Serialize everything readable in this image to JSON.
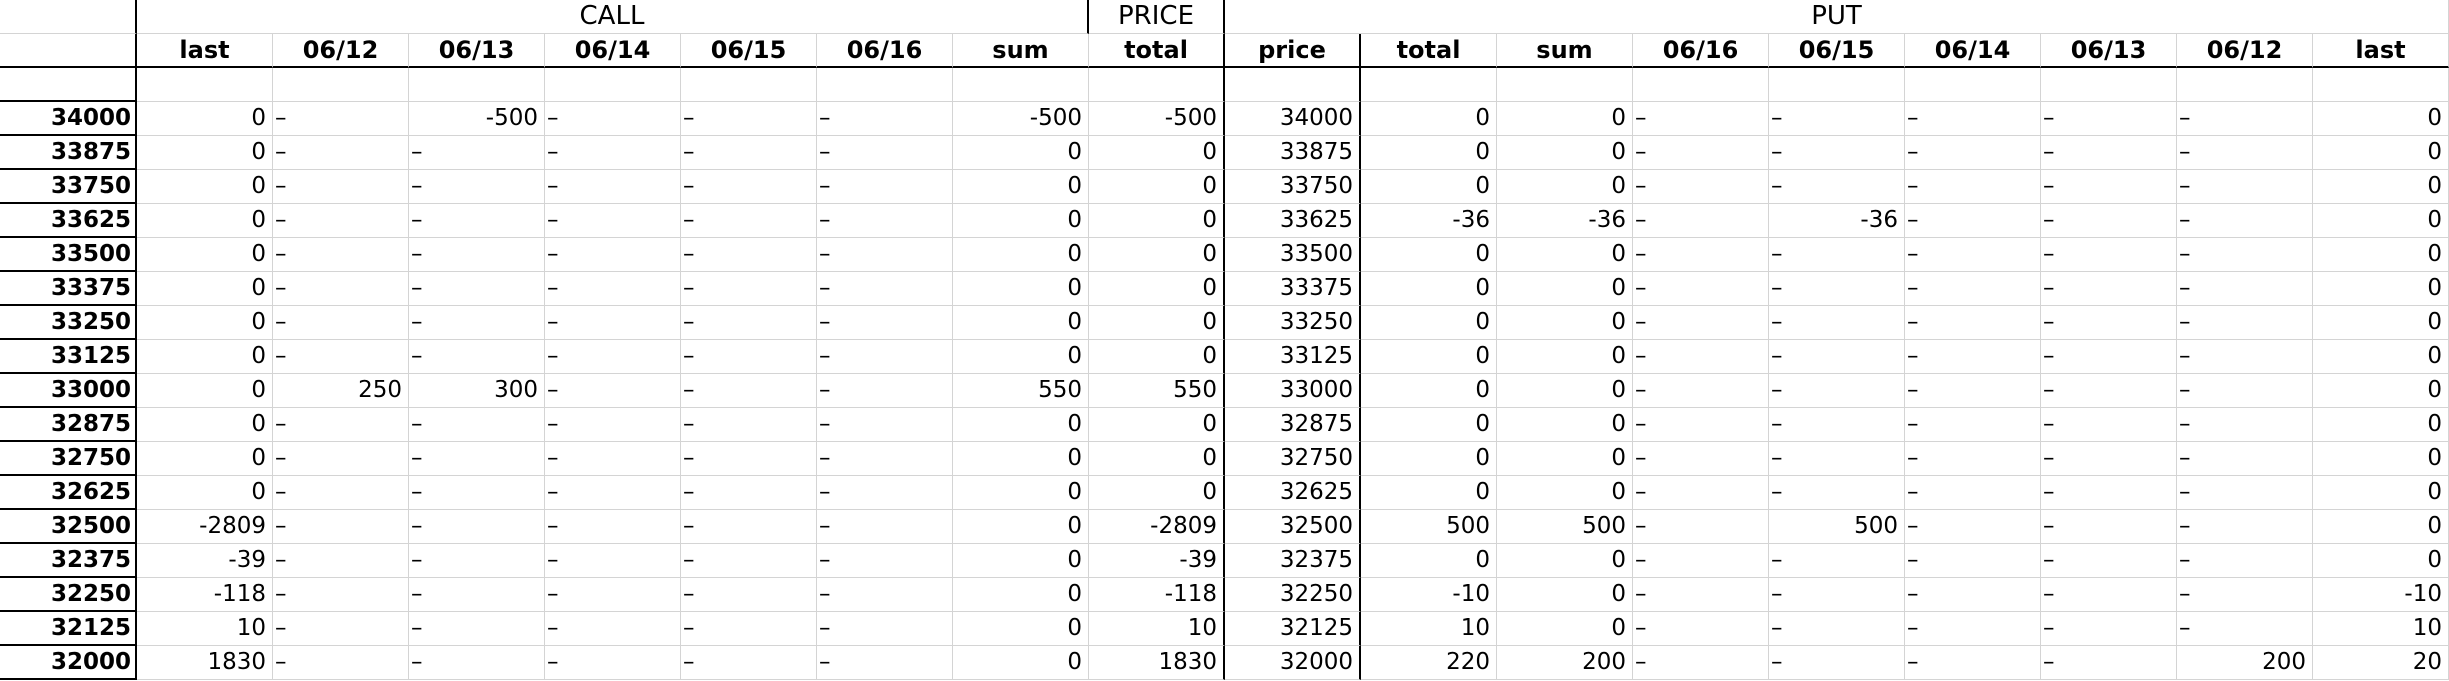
{
  "groups": {
    "call": "CALL",
    "price": "PRICE",
    "put": "PUT"
  },
  "headers": [
    "last",
    "06/12",
    "06/13",
    "06/14",
    "06/15",
    "06/16",
    "sum",
    "total",
    "price",
    "total",
    "sum",
    "06/16",
    "06/15",
    "06/14",
    "06/13",
    "06/12",
    "last"
  ],
  "rows": [
    {
      "strike": "34000",
      "cells": [
        "0",
        "–",
        "-500",
        "–",
        "–",
        "–",
        "-500",
        "-500",
        "34000",
        "0",
        "0",
        "–",
        "–",
        "–",
        "–",
        "–",
        "0"
      ]
    },
    {
      "strike": "33875",
      "cells": [
        "0",
        "–",
        "–",
        "–",
        "–",
        "–",
        "0",
        "0",
        "33875",
        "0",
        "0",
        "–",
        "–",
        "–",
        "–",
        "–",
        "0"
      ]
    },
    {
      "strike": "33750",
      "cells": [
        "0",
        "–",
        "–",
        "–",
        "–",
        "–",
        "0",
        "0",
        "33750",
        "0",
        "0",
        "–",
        "–",
        "–",
        "–",
        "–",
        "0"
      ]
    },
    {
      "strike": "33625",
      "cells": [
        "0",
        "–",
        "–",
        "–",
        "–",
        "–",
        "0",
        "0",
        "33625",
        "-36",
        "-36",
        "–",
        "-36",
        "–",
        "–",
        "–",
        "0"
      ]
    },
    {
      "strike": "33500",
      "cells": [
        "0",
        "–",
        "–",
        "–",
        "–",
        "–",
        "0",
        "0",
        "33500",
        "0",
        "0",
        "–",
        "–",
        "–",
        "–",
        "–",
        "0"
      ]
    },
    {
      "strike": "33375",
      "cells": [
        "0",
        "–",
        "–",
        "–",
        "–",
        "–",
        "0",
        "0",
        "33375",
        "0",
        "0",
        "–",
        "–",
        "–",
        "–",
        "–",
        "0"
      ]
    },
    {
      "strike": "33250",
      "cells": [
        "0",
        "–",
        "–",
        "–",
        "–",
        "–",
        "0",
        "0",
        "33250",
        "0",
        "0",
        "–",
        "–",
        "–",
        "–",
        "–",
        "0"
      ]
    },
    {
      "strike": "33125",
      "cells": [
        "0",
        "–",
        "–",
        "–",
        "–",
        "–",
        "0",
        "0",
        "33125",
        "0",
        "0",
        "–",
        "–",
        "–",
        "–",
        "–",
        "0"
      ]
    },
    {
      "strike": "33000",
      "cells": [
        "0",
        "250",
        "300",
        "–",
        "–",
        "–",
        "550",
        "550",
        "33000",
        "0",
        "0",
        "–",
        "–",
        "–",
        "–",
        "–",
        "0"
      ]
    },
    {
      "strike": "32875",
      "cells": [
        "0",
        "–",
        "–",
        "–",
        "–",
        "–",
        "0",
        "0",
        "32875",
        "0",
        "0",
        "–",
        "–",
        "–",
        "–",
        "–",
        "0"
      ]
    },
    {
      "strike": "32750",
      "cells": [
        "0",
        "–",
        "–",
        "–",
        "–",
        "–",
        "0",
        "0",
        "32750",
        "0",
        "0",
        "–",
        "–",
        "–",
        "–",
        "–",
        "0"
      ]
    },
    {
      "strike": "32625",
      "cells": [
        "0",
        "–",
        "–",
        "–",
        "–",
        "–",
        "0",
        "0",
        "32625",
        "0",
        "0",
        "–",
        "–",
        "–",
        "–",
        "–",
        "0"
      ]
    },
    {
      "strike": "32500",
      "cells": [
        "-2809",
        "–",
        "–",
        "–",
        "–",
        "–",
        "0",
        "-2809",
        "32500",
        "500",
        "500",
        "–",
        "500",
        "–",
        "–",
        "–",
        "0"
      ]
    },
    {
      "strike": "32375",
      "cells": [
        "-39",
        "–",
        "–",
        "–",
        "–",
        "–",
        "0",
        "-39",
        "32375",
        "0",
        "0",
        "–",
        "–",
        "–",
        "–",
        "–",
        "0"
      ]
    },
    {
      "strike": "32250",
      "cells": [
        "-118",
        "–",
        "–",
        "–",
        "–",
        "–",
        "0",
        "-118",
        "32250",
        "-10",
        "0",
        "–",
        "–",
        "–",
        "–",
        "–",
        "-10"
      ]
    },
    {
      "strike": "32125",
      "cells": [
        "10",
        "–",
        "–",
        "–",
        "–",
        "–",
        "0",
        "10",
        "32125",
        "10",
        "0",
        "–",
        "–",
        "–",
        "–",
        "–",
        "10"
      ]
    },
    {
      "strike": "32000",
      "cells": [
        "1830",
        "–",
        "–",
        "–",
        "–",
        "–",
        "0",
        "1830",
        "32000",
        "220",
        "200",
        "–",
        "–",
        "–",
        "–",
        "200",
        "20"
      ]
    }
  ]
}
